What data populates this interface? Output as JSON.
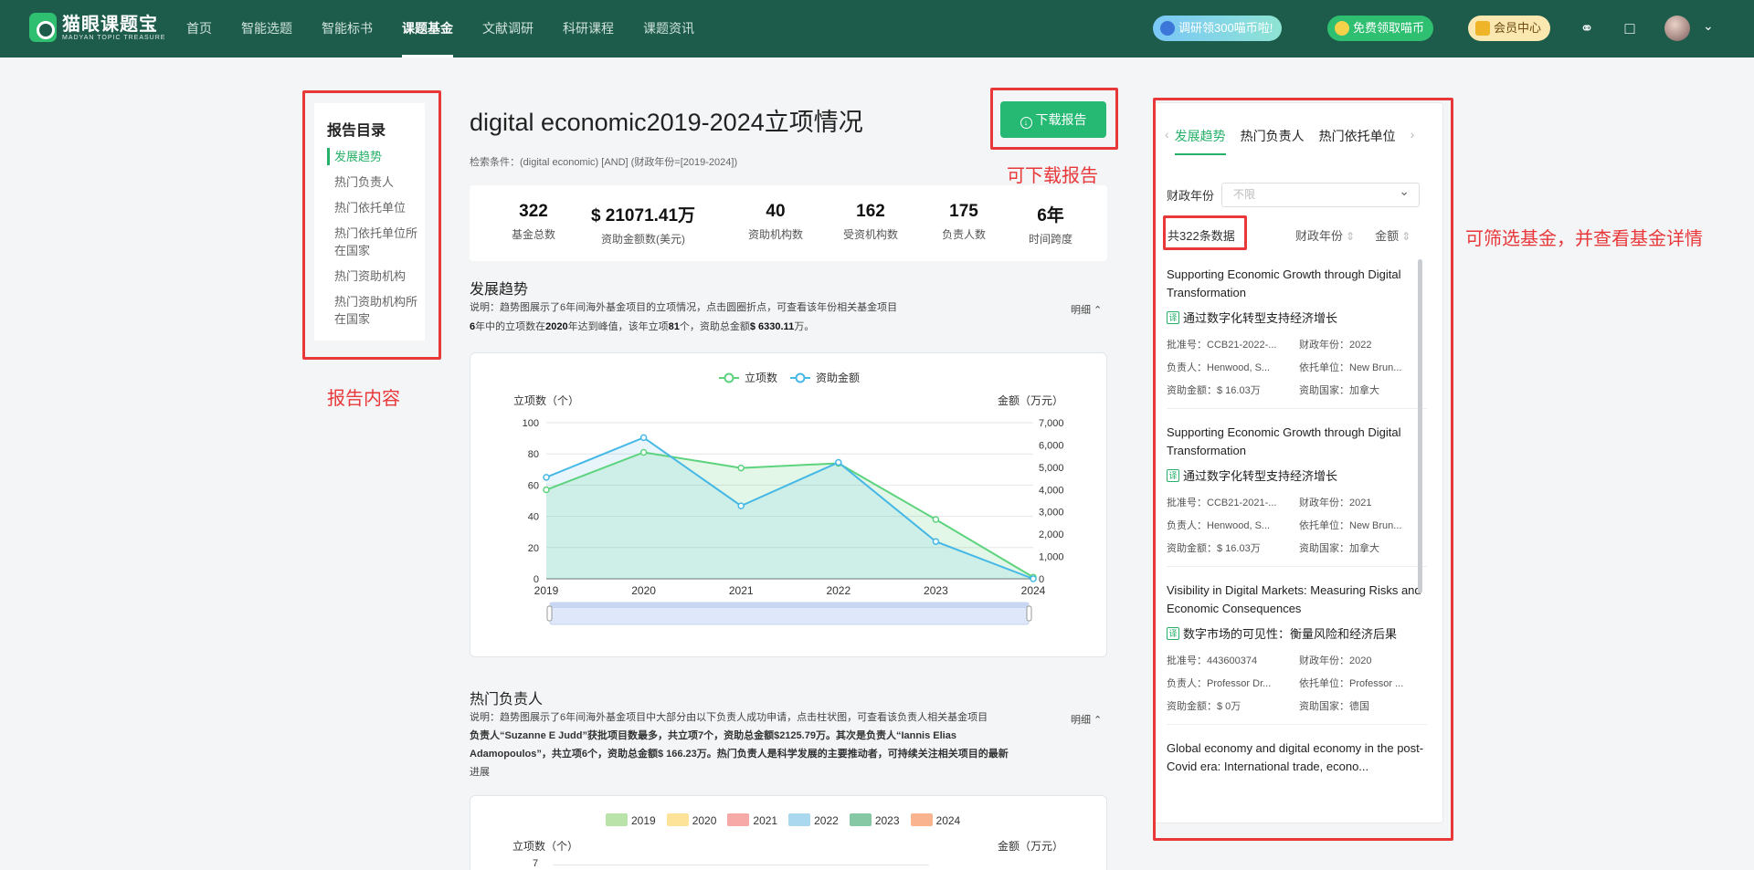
{
  "header": {
    "logo_cn": "猫眼课题宝",
    "logo_en": "MADYAN TOPIC TREASURE",
    "nav": [
      "首页",
      "智能选题",
      "智能标书",
      "课题基金",
      "文献调研",
      "科研课程",
      "课题资讯"
    ],
    "active_nav": 3,
    "promo_1": "调研领300喵币啦!",
    "promo_2": "免费领取喵币",
    "vip": "会员中心"
  },
  "catalog": {
    "title": "报告目录",
    "items": [
      "发展趋势",
      "热门负责人",
      "热门依托单位",
      "热门依托单位所在国家",
      "热门资助机构",
      "热门资助机构所在国家"
    ]
  },
  "annotations": {
    "report_content": "报告内容",
    "download": "可下载报告",
    "filter": "可筛选基金，并查看基金详情"
  },
  "report": {
    "title": "digital economic2019-2024立项情况",
    "criteria": "检索条件：(digital economic) [AND] (财政年份=[2019-2024])",
    "download_label": "下载报告",
    "stats": [
      {
        "value": "322",
        "label": "基金总数"
      },
      {
        "value": "$ 21071.41万",
        "label": "资助金额数(美元)"
      },
      {
        "value": "40",
        "label": "资助机构数"
      },
      {
        "value": "162",
        "label": "受资机构数"
      },
      {
        "value": "175",
        "label": "负责人数"
      },
      {
        "value": "6年",
        "label": "时间跨度"
      }
    ]
  },
  "trend": {
    "title": "发展趋势",
    "desc_1": "说明：趋势图展示了6年间海外基金项目的立项情况，点击圆圈折点，可查看该年份相关基金项目",
    "desc_2a": "6",
    "desc_2b": "年中的立项数在",
    "desc_2c": "2020",
    "desc_2d": "年达到峰值，该年立项",
    "desc_2e": "81",
    "desc_2f": "个，资助总金额",
    "desc_2g": "$ 6330.11",
    "desc_2h": "万。",
    "toggle": "明细 ⌃"
  },
  "chart_data": {
    "type": "line",
    "x": [
      2019,
      2020,
      2021,
      2022,
      2023,
      2024
    ],
    "series": [
      {
        "name": "立项数",
        "axis": "left",
        "color": "#5dd37e",
        "values": [
          57,
          81,
          71,
          74,
          38,
          1
        ]
      },
      {
        "name": "资助金额",
        "axis": "right",
        "color": "#45b8e6",
        "values": [
          4550,
          6330,
          3270,
          5220,
          1670,
          0
        ]
      }
    ],
    "ylabel_left": "立项数（个）",
    "ylabel_right": "金额（万元）",
    "ylim_left": [
      0,
      100
    ],
    "ylim_right": [
      0,
      7000
    ],
    "yticks_left": [
      "0",
      "20",
      "40",
      "60",
      "80",
      "100"
    ],
    "yticks_right": [
      "0",
      "1,000",
      "2,000",
      "3,000",
      "4,000",
      "5,000",
      "6,000",
      "7,000"
    ],
    "legend": "top-center",
    "grid": true
  },
  "leaders": {
    "title": "热门负责人",
    "desc_1": "说明：趋势图展示了6年间海外基金项目中大部分由以下负责人成功申请，点击柱状图，可查看该负责人相关基金项目",
    "desc_2": "负责人“Suzanne E Judd”获批项目数最多，共立项7个，资助总金额$2125.79万。其次是负责人“Iannis Elias",
    "desc_3": "Adamopoulos”，共立项6个，资助总金额$ 166.23万。热门负责人是科学发展的主要推动者，可持续关注相关项目的最新",
    "desc_4": "进展",
    "toggle": "明细 ⌃",
    "legend": [
      "2019",
      "2020",
      "2021",
      "2022",
      "2023",
      "2024"
    ],
    "legend_colors": [
      "#b9e3a8",
      "#fde29a",
      "#f6a9a6",
      "#a9d8ef",
      "#86c8a3",
      "#f9b48f"
    ],
    "ylabel_left": "立项数（个）",
    "ylabel_right": "金额（万元）",
    "first_tick": "7"
  },
  "panel": {
    "tabs": [
      "发展趋势",
      "热门负责人",
      "热门依托单位"
    ],
    "filter_label": "财政年份",
    "filter_placeholder": "不限",
    "total": "共322条数据",
    "sort_1": "财政年份",
    "sort_2": "金额",
    "items": [
      {
        "title": "Supporting Economic Growth through Digital Transformation",
        "title_cn": "通过数字化转型支持经济增长",
        "no": "批准号：CCB21-2022-...",
        "year": "财政年份：2022",
        "leader": "负责人：Henwood, S...",
        "unit": "依托单位：New Brun...",
        "amount": "资助金额：$ 16.03万",
        "country": "资助国家：加拿大"
      },
      {
        "title": "Supporting Economic Growth through Digital Transformation",
        "title_cn": "通过数字化转型支持经济增长",
        "no": "批准号：CCB21-2021-...",
        "year": "财政年份：2021",
        "leader": "负责人：Henwood, S...",
        "unit": "依托单位：New Brun...",
        "amount": "资助金额：$ 16.03万",
        "country": "资助国家：加拿大"
      },
      {
        "title": "Visibility in Digital Markets: Measuring Risks and Economic Consequences",
        "title_cn": "数字市场的可见性：衡量风险和经济后果",
        "no": "批准号：443600374",
        "year": "财政年份：2020",
        "leader": "负责人：Professor Dr...",
        "unit": "依托单位：Professor ...",
        "amount": "资助金额：$ 0万",
        "country": "资助国家：德国"
      },
      {
        "title": "Global economy and digital economy in the post-Covid era: International trade, econo..."
      }
    ]
  },
  "translate_badge": "译"
}
